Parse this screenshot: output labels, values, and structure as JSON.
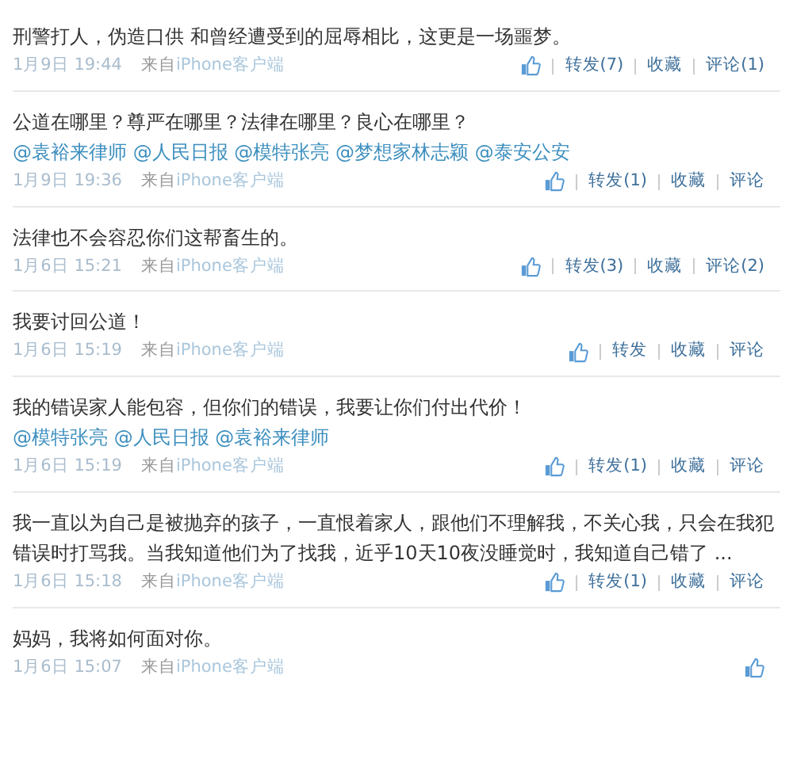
{
  "posts": [
    {
      "parts": [
        {
          "kind": "plain",
          "text": "刑警打人，伪造口供 和曾经遭受到的屈辱相比，这更是一场噩梦。"
        }
      ],
      "time": "1月9日 19:44",
      "source_label": "来自",
      "source": "iPhone客户端",
      "actions": [
        "转发(7)",
        "收藏",
        "评论(1)"
      ]
    },
    {
      "parts": [
        {
          "kind": "plain",
          "text": "公道在哪里？尊严在哪里？法律在哪里？良心在哪里？"
        },
        {
          "kind": "mention",
          "text": "@袁裕来律师"
        },
        {
          "kind": "mention",
          "text": "@人民日报"
        },
        {
          "kind": "mention",
          "text": "@模特张亮"
        },
        {
          "kind": "mention",
          "text": "@梦想家林志颖"
        },
        {
          "kind": "mention",
          "text": "@泰安公安"
        }
      ],
      "time": "1月9日 19:36",
      "source_label": "来自",
      "source": "iPhone客户端",
      "actions": [
        "转发(1)",
        "收藏",
        "评论"
      ]
    },
    {
      "parts": [
        {
          "kind": "plain",
          "text": "法律也不会容忍你们这帮畜生的。"
        }
      ],
      "time": "1月6日 15:21",
      "source_label": "来自",
      "source": "iPhone客户端",
      "actions": [
        "转发(3)",
        "收藏",
        "评论(2)"
      ]
    },
    {
      "parts": [
        {
          "kind": "plain",
          "text": "我要讨回公道！"
        }
      ],
      "time": "1月6日 15:19",
      "source_label": "来自",
      "source": "iPhone客户端",
      "actions": [
        "转发",
        "收藏",
        "评论"
      ]
    },
    {
      "parts": [
        {
          "kind": "plain",
          "text": "我的错误家人能包容，但你们的错误，我要让你们付出代价！"
        },
        {
          "kind": "mention",
          "text": "@模特张亮"
        },
        {
          "kind": "mention",
          "text": "@人民日报"
        },
        {
          "kind": "mention",
          "text": "@袁裕来律师"
        }
      ],
      "time": "1月6日 15:19",
      "source_label": "来自",
      "source": "iPhone客户端",
      "actions": [
        "转发(1)",
        "收藏",
        "评论"
      ]
    },
    {
      "parts": [
        {
          "kind": "plain",
          "text": "我一直以为自己是被抛弃的孩子，一直恨着家人，跟他们不理解我，不关心我，只会在我犯错误时打骂我。当我知道他们为了找我，近乎10天10夜没睡觉时，我知道自己错了 ..."
        }
      ],
      "time": "1月6日 15:18",
      "source_label": "来自",
      "source": "iPhone客户端",
      "actions": [
        "转发(1)",
        "收藏",
        "评论"
      ]
    },
    {
      "parts": [
        {
          "kind": "plain",
          "text": "妈妈，我将如何面对你。"
        }
      ],
      "time": "1月6日 15:07",
      "source_label": "来自",
      "source": "iPhone客户端"
    }
  ]
}
